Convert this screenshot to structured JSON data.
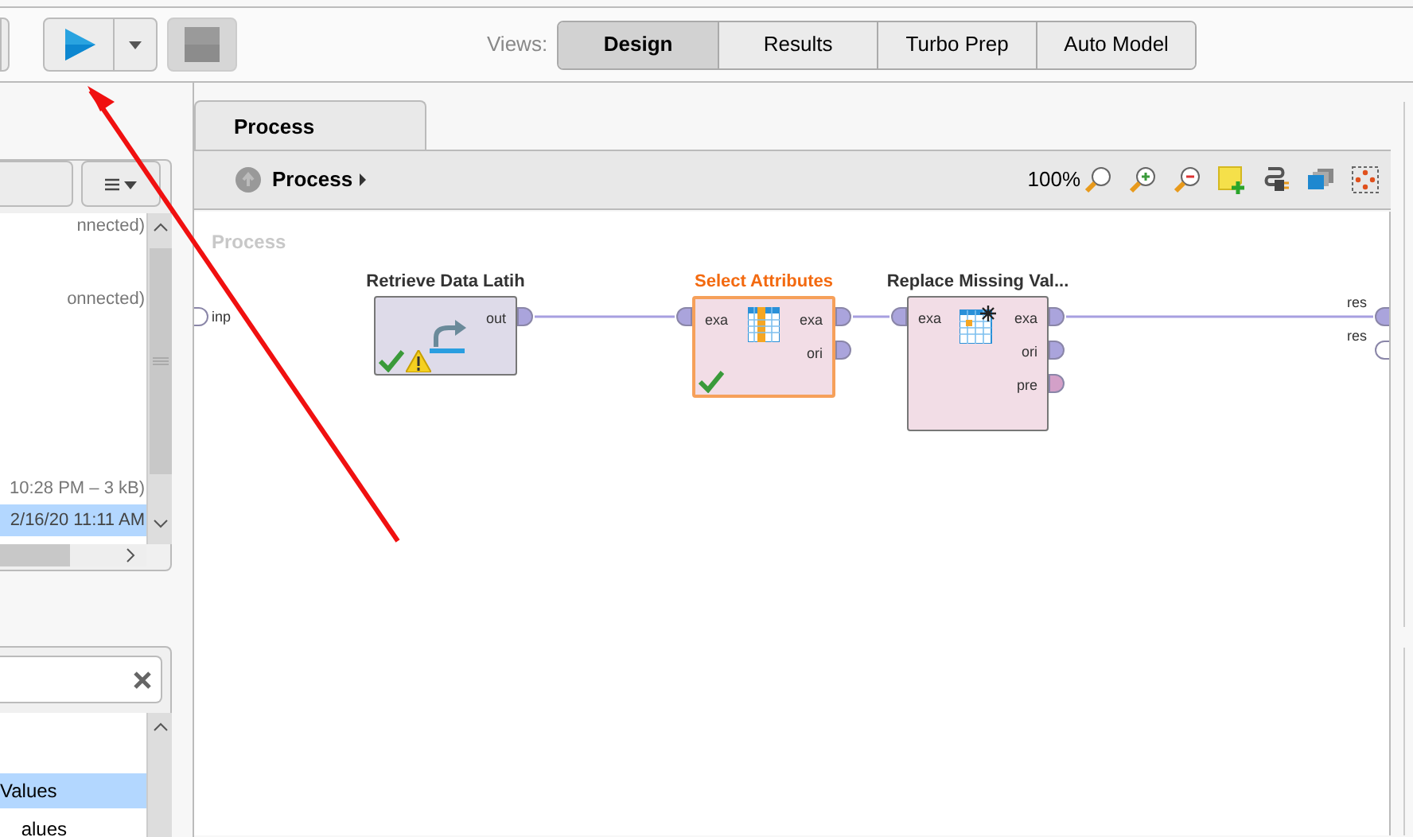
{
  "toolbar": {
    "views_label": "Views:",
    "views": [
      {
        "label": "Design",
        "selected": true
      },
      {
        "label": "Results",
        "selected": false
      },
      {
        "label": "Turbo Prep",
        "selected": false
      },
      {
        "label": "Auto Model",
        "selected": false
      }
    ],
    "stop_disabled": true
  },
  "repository": {
    "rows": [
      {
        "text": "nnected)",
        "selected": false
      },
      {
        "text": "onnected)",
        "selected": false
      },
      {
        "text": "10:28 PM – 3 kB)",
        "selected": false
      },
      {
        "text": "2/16/20 11:11 AM",
        "selected": true
      }
    ]
  },
  "operators_panel": {
    "rows": [
      {
        "text": "Values",
        "selected": true
      },
      {
        "text": "alues",
        "selected": false
      }
    ]
  },
  "editor": {
    "tab": "Process",
    "breadcrumb": "Process",
    "zoom": "100%",
    "canvas_title": "Process",
    "process_inputs": [
      {
        "label": "inp",
        "connected": false
      }
    ],
    "process_outputs": [
      {
        "label": "res",
        "connected": true
      },
      {
        "label": "res",
        "connected": false
      }
    ],
    "operators": [
      {
        "name": "Retrieve Data Latih",
        "kind": "retrieve",
        "selected": false,
        "outputs": [
          {
            "label": "out",
            "color": "#aaa4dc"
          }
        ],
        "ok": true,
        "warning": true
      },
      {
        "name": "Select Attributes",
        "kind": "select",
        "selected": true,
        "inputs": [
          {
            "label": "exa",
            "color": "#aaa4dc"
          }
        ],
        "outputs": [
          {
            "label": "exa",
            "color": "#aaa4dc"
          },
          {
            "label": "ori",
            "color": "#aaa4dc"
          }
        ],
        "ok": true
      },
      {
        "name": "Replace Missing Val...",
        "kind": "replace",
        "selected": false,
        "inputs": [
          {
            "label": "exa",
            "color": "#aaa4dc"
          }
        ],
        "outputs": [
          {
            "label": "exa",
            "color": "#aaa4dc"
          },
          {
            "label": "ori",
            "color": "#aaa4dc"
          },
          {
            "label": "pre",
            "color": "#d3a0c8"
          }
        ]
      }
    ]
  }
}
